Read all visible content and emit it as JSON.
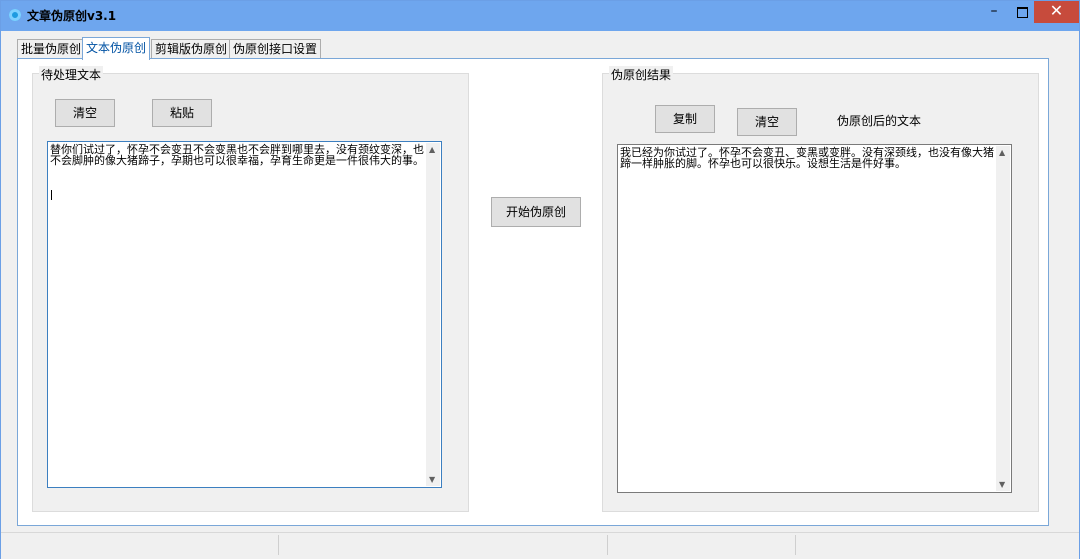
{
  "window": {
    "title": "文章伪原创v3.1",
    "close_glyph": "✕",
    "min_glyph": "–"
  },
  "tabs": [
    {
      "label": "批量伪原创"
    },
    {
      "label": "文本伪原创"
    },
    {
      "label": "剪辑版伪原创"
    },
    {
      "label": "伪原创接口设置"
    }
  ],
  "input_group": {
    "title": "待处理文本",
    "clear_label": "清空",
    "paste_label": "粘贴",
    "text": "替你们试过了，怀孕不会变丑不会变黑也不会胖到哪里去，没有颈纹变深，也不会脚肿的像大猪蹄子，孕期也可以很幸福，孕育生命更是一件很伟大的事。"
  },
  "start_label": "开始伪原创",
  "output_group": {
    "title": "伪原创结果",
    "copy_label": "复制",
    "clear_label": "清空",
    "caption": "伪原创后的文本",
    "text": "我已经为你试过了。怀孕不会变丑、变黑或变胖。没有深颈线，也没有像大猪蹄一样肿胀的脚。怀孕也可以很快乐。设想生活是件好事。"
  },
  "icons": {
    "scroll_up": "▲",
    "scroll_down": "▼"
  }
}
